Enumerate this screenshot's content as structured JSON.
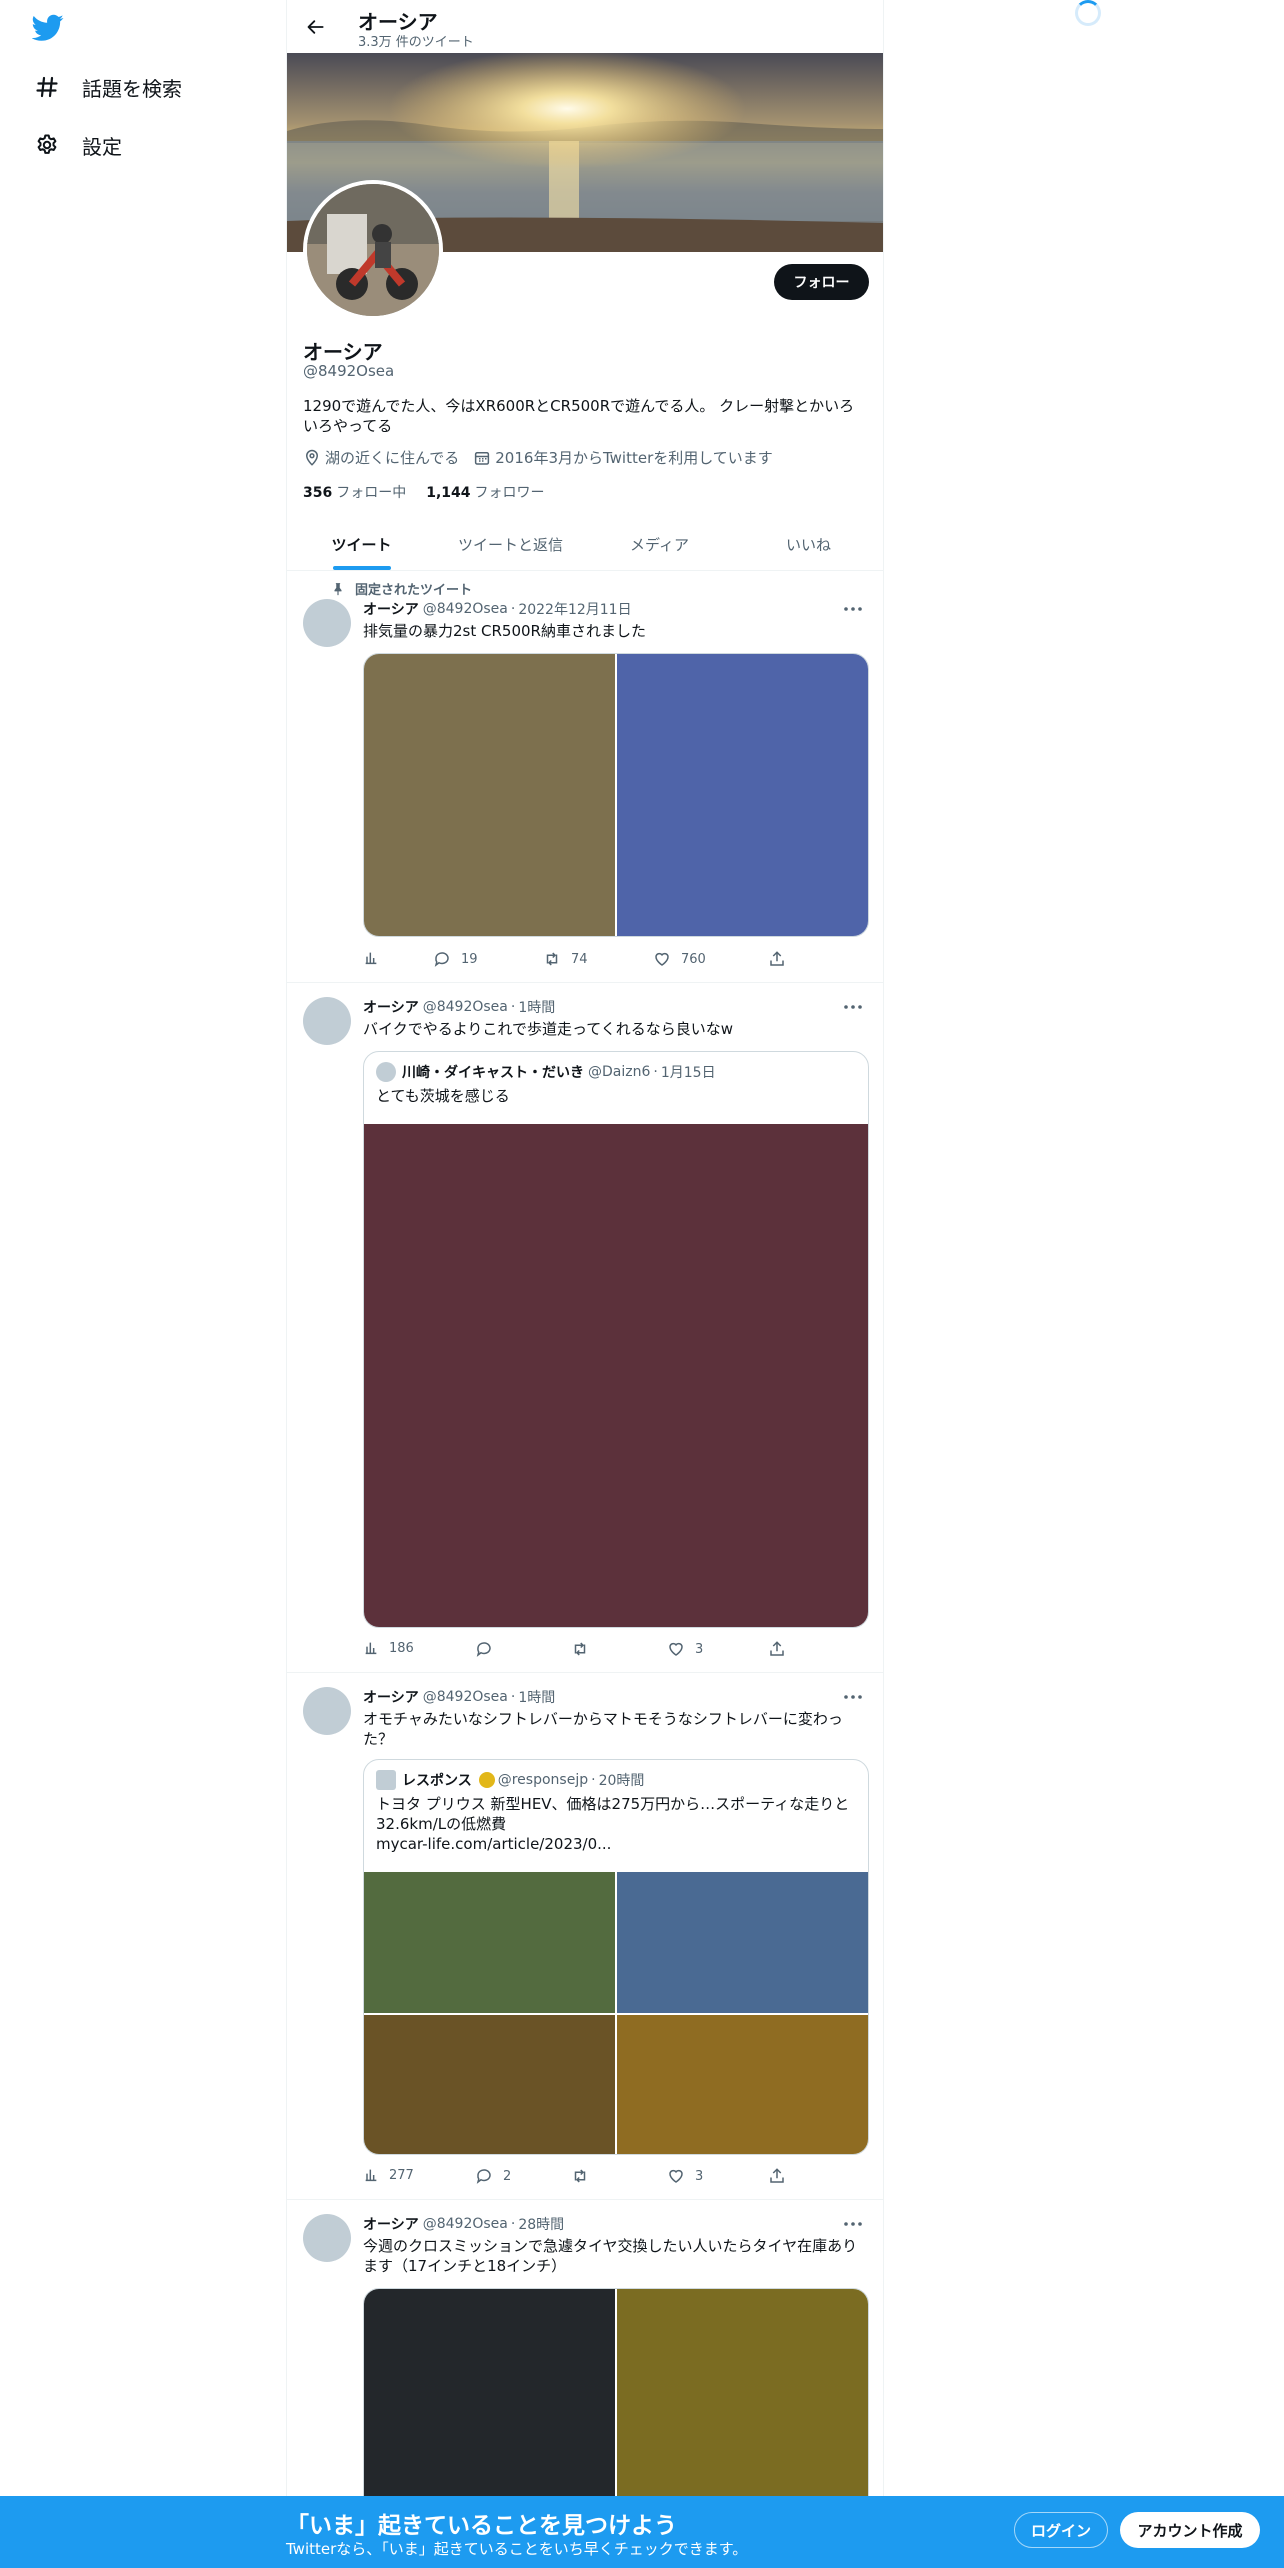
{
  "nav": {
    "logo_icon": "twitter-bird-icon",
    "explore_label": "話題を検索",
    "settings_label": "設定"
  },
  "header": {
    "title": "オーシア",
    "tweet_count": "3.3万 件のツイート"
  },
  "profile": {
    "name": "オーシア",
    "handle": "@8492Osea",
    "follow_label": "フォロー",
    "bio": "1290で遊んでた人、今はXR600RとCR500Rで遊んでる人。 クレー射撃とかいろいろやってる",
    "location": "湖の近くに住んでる",
    "joined": "2016年3月からTwitterを利用しています",
    "following_count": "356",
    "following_label": "フォロー中",
    "followers_count": "1,144",
    "followers_label": "フォロワー"
  },
  "tabs": [
    "ツイート",
    "ツイートと返信",
    "メディア",
    "いいね"
  ],
  "tweets": [
    {
      "pinned_label": "固定されたツイート",
      "name": "オーシア",
      "handle": "@8492Osea",
      "time": "2022年12月11日",
      "text": "排気量の暴力2st CR500R納車されました",
      "media_colors": [
        "#7d704e",
        "#4f64a9"
      ],
      "views": "",
      "replies": "19",
      "retweets": "74",
      "likes": "760"
    },
    {
      "name": "オーシア",
      "handle": "@8492Osea",
      "time": "1時間",
      "text": "バイクでやるよりこれで歩道走ってくれるなら良いなw",
      "quote": {
        "name": "川崎・ダイキャスト・だいき",
        "handle": "@Daizn6",
        "time": "1月15日",
        "text": "とても茨城を感じる",
        "media_color": "#5c313b"
      },
      "views": "186",
      "replies": "",
      "retweets": "",
      "likes": "3"
    },
    {
      "name": "オーシア",
      "handle": "@8492Osea",
      "time": "1時間",
      "text": "オモチャみたいなシフトレバーからマトモそうなシフトレバーに変わった？",
      "quote": {
        "name": "レスポンス",
        "handle": "@responsejp",
        "time": "20時間",
        "text": "トヨタ プリウス 新型HEV、価格は275万円から…スポーティな走りと32.6km/Lの低燃費",
        "link": "mycar-life.com/article/2023/0...",
        "media_colors": [
          "#536b3f",
          "#4a6a93",
          "#6a5326",
          "#8f6c22"
        ]
      },
      "views": "277",
      "replies": "2",
      "retweets": "",
      "likes": "3"
    },
    {
      "name": "オーシア",
      "handle": "@8492Osea",
      "time": "28時間",
      "text": "今週のクロスミッションで急遽タイヤ交換したい人いたらタイヤ在庫あります（17インチと18インチ）",
      "media_colors": [
        "#23272b",
        "#7b6c22"
      ]
    }
  ],
  "bottom": {
    "title": "「いま」起きていることを見つけよう",
    "subtitle": "Twitterなら、「いま」起きていることをいち早くチェックできます。",
    "login": "ログイン",
    "signup": "アカウント作成"
  },
  "colors": {
    "accent": "#1d9bf0",
    "text": "#0f1419",
    "muted": "#536471"
  }
}
